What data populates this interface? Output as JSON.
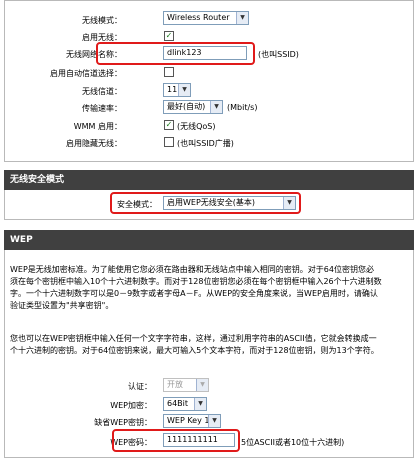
{
  "wireless": {
    "mode_label": "无线模式：",
    "mode_value": "Wireless Router",
    "enable_label": "启用无线：",
    "ssid_label": "无线网络名称：",
    "ssid_value": "dlink123",
    "ssid_note": "(也叫SSID)",
    "auto_channel_label": "启用自动信道选择：",
    "channel_label": "无线信道：",
    "channel_value": "11",
    "rate_label": "传输速率：",
    "rate_value": "最好(自动)",
    "rate_unit": "(Mbit/s)",
    "wmm_label": "WMM 启用：",
    "wmm_note": "(无线QoS)",
    "hidden_label": "启用隐藏无线：",
    "hidden_note": "(也叫SSID广播)"
  },
  "security": {
    "header": "无线安全模式",
    "mode_label": "安全模式：",
    "mode_value": "启用WEP无线安全(基本)"
  },
  "wep": {
    "header": "WEP",
    "para1_line1": "WEP是无线加密标准。为了能使用它您必须在路由器和无线站点中输入相同的密钥。对于64位密钥您必",
    "para1_line2": "须在每个密钥框中输入10个十六进制数字。而对于128位密钥您必须在每个密钥框中输入26个十六进制数",
    "para1_line3": "字。一个十六进制数字可以是0－9数字或者字母A－F。从WEP的安全角度来说，当WEP启用时，请确认",
    "para1_line4": "验证类型设置为\"共享密钥\"。",
    "para2_line1": "您也可以在WEP密钥框中输入任何一个文字字符串，这样，通过利用字符串的ASCII值，它就会转换成一",
    "para2_line2": "个十六进制的密钥。对于64位密钥来说，最大可输入5个文本字符，而对于128位密钥，则为13个字符。",
    "auth_label": "认证：",
    "auth_value": "开放",
    "encryption_label": "WEP加密：",
    "encryption_value": "64Bit",
    "default_key_label": "缺省WEP密钥：",
    "default_key_value": "WEP Key 1",
    "key_label": "WEP密码：",
    "key_value": "1111111111",
    "key_note": "5位ASCII或者10位十六进制)"
  },
  "colors": {
    "highlight": "#e01a1a",
    "header_bg": "#404040"
  }
}
